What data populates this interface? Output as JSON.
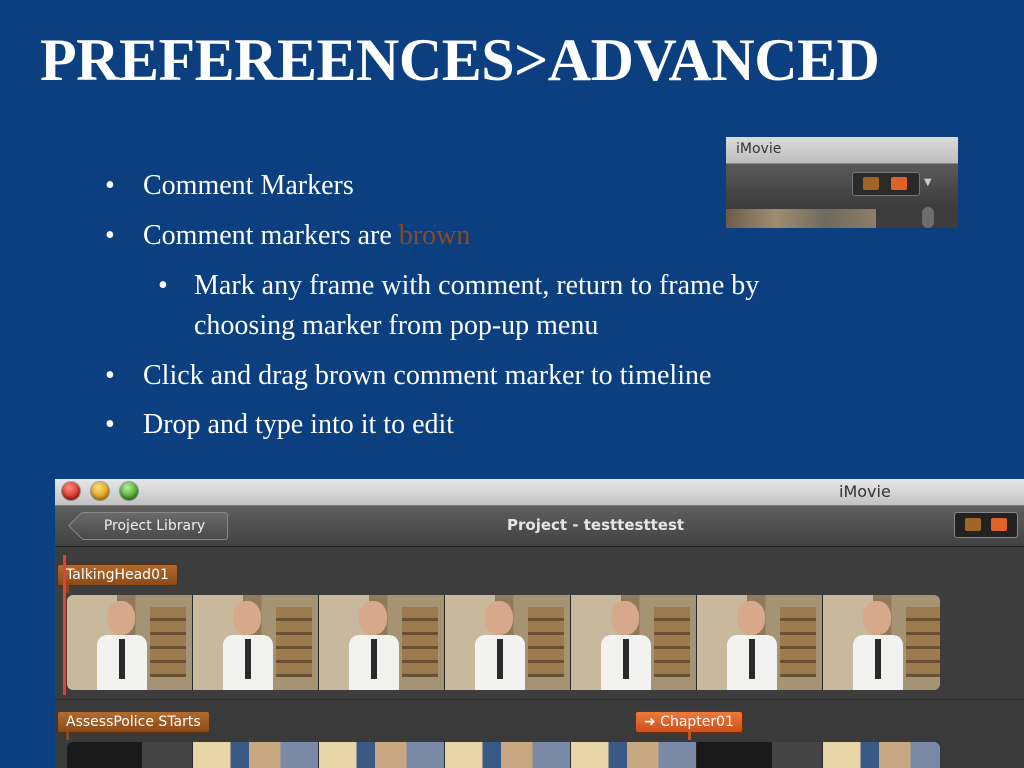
{
  "slide": {
    "title": "PREFEREENCES>ADVANCED",
    "bullet_char": "•",
    "bullets": [
      {
        "text": "Comment Markers"
      },
      {
        "text": "Comment markers are ",
        "highlight": "brown",
        "highlight_color": "#8a4a1c"
      },
      {
        "text": "Mark any frame with comment, return to frame by",
        "text2": "choosing marker from pop-up menu"
      },
      {
        "text": "Click and drag brown comment marker to timeline"
      },
      {
        "text": "Drop and type into it to edit"
      }
    ]
  },
  "mini_window": {
    "title": "iMovie",
    "buttons": [
      "comment-marker-icon",
      "chapter-marker-icon"
    ]
  },
  "imovie": {
    "app_title": "iMovie",
    "back_button": "Project Library",
    "project_title": "Project - testtesttest",
    "tracks": [
      {
        "marker": "TalkingHead01",
        "marker_type": "comment"
      },
      {
        "marker": "AssessPolice STarts",
        "marker_type": "comment"
      },
      {
        "marker": "➜ Chapter01",
        "marker_type": "chapter"
      }
    ]
  },
  "colors": {
    "background": "#0b3f80",
    "comment_marker": "#9c5a22",
    "chapter_marker": "#e0622a",
    "playhead": "#e04040"
  }
}
